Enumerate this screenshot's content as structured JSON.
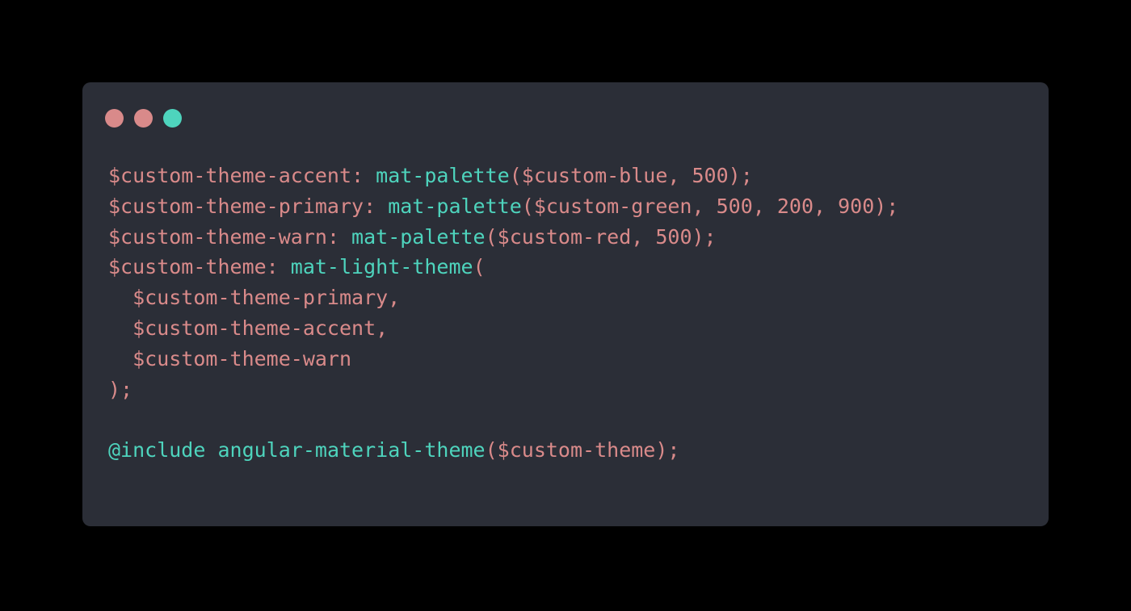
{
  "window": {
    "controls": [
      {
        "name": "close",
        "color": "#d98a8a"
      },
      {
        "name": "minimize",
        "color": "#d98a8a"
      },
      {
        "name": "maximize",
        "color": "#4ed4bd"
      }
    ]
  },
  "colors": {
    "background": "#000000",
    "window": "#2b2e37",
    "variable": "#d98a8a",
    "function": "#4ed4bd"
  },
  "code": {
    "lines": [
      [
        {
          "t": "$custom-theme-accent",
          "k": "var"
        },
        {
          "t": ": ",
          "k": "punct"
        },
        {
          "t": "mat-palette",
          "k": "fn"
        },
        {
          "t": "($custom-blue, 500);",
          "k": "var"
        }
      ],
      [
        {
          "t": "$custom-theme-primary",
          "k": "var"
        },
        {
          "t": ": ",
          "k": "punct"
        },
        {
          "t": "mat-palette",
          "k": "fn"
        },
        {
          "t": "($custom-green, 500, 200, 900);",
          "k": "var"
        }
      ],
      [
        {
          "t": "$custom-theme-warn",
          "k": "var"
        },
        {
          "t": ": ",
          "k": "punct"
        },
        {
          "t": "mat-palette",
          "k": "fn"
        },
        {
          "t": "($custom-red, 500);",
          "k": "var"
        }
      ],
      [
        {
          "t": "$custom-theme",
          "k": "var"
        },
        {
          "t": ": ",
          "k": "punct"
        },
        {
          "t": "mat-light-theme",
          "k": "fn"
        },
        {
          "t": "(",
          "k": "punct"
        }
      ],
      [
        {
          "t": "  $custom-theme-primary,",
          "k": "var"
        }
      ],
      [
        {
          "t": "  $custom-theme-accent,",
          "k": "var"
        }
      ],
      [
        {
          "t": "  $custom-theme-warn",
          "k": "var"
        }
      ],
      [
        {
          "t": ");",
          "k": "punct"
        }
      ],
      [
        {
          "t": "",
          "k": "punct"
        }
      ],
      [
        {
          "t": "@include",
          "k": "fn"
        },
        {
          "t": " ",
          "k": "punct"
        },
        {
          "t": "angular-material-theme",
          "k": "fn"
        },
        {
          "t": "($custom-theme);",
          "k": "var"
        }
      ]
    ]
  }
}
